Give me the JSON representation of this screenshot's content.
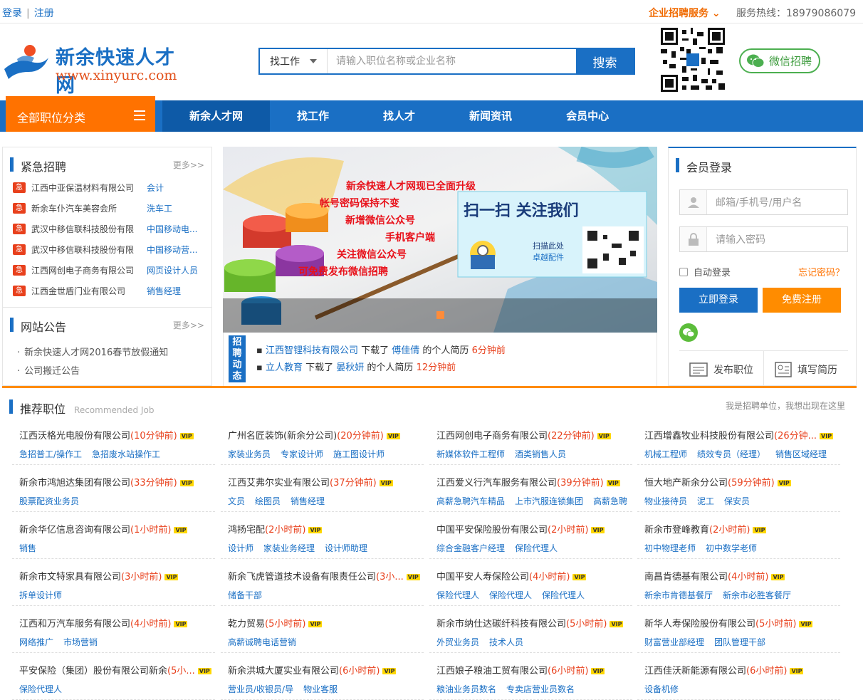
{
  "topbar": {
    "login": "登录",
    "register": "注册",
    "service": "企业招聘服务",
    "hotline": "服务热线：18979086079"
  },
  "logo": {
    "title": "新余快速人才网",
    "url": "www.xinyurc.com"
  },
  "search": {
    "type": "找工作",
    "placeholder": "请输入职位名称或企业名称",
    "button": "搜索"
  },
  "wechat_btn": "微信招聘",
  "nav": {
    "all": "全部职位分类",
    "items": [
      "新余人才网",
      "找工作",
      "找人才",
      "新闻资讯",
      "会员中心"
    ]
  },
  "urgent": {
    "title": "紧急招聘",
    "more": "更多>>",
    "tag": "急",
    "items": [
      {
        "company": "江西中亚保温材料有限公司",
        "job": "会计"
      },
      {
        "company": "新余车仆汽车美容会所",
        "job": "洗车工"
      },
      {
        "company": "武汉中移信联科技股份有限",
        "job": "中国移动电..."
      },
      {
        "company": "武汉中移信联科技股份有限",
        "job": "中国移动营..."
      },
      {
        "company": "江西网创电子商务有限公司",
        "job": "网页设计人员"
      },
      {
        "company": "江西金世盾门业有限公司",
        "job": "销售经理"
      }
    ]
  },
  "notice": {
    "title": "网站公告",
    "more": "更多>>",
    "items": [
      "新余快速人才网2016春节放假通知",
      "公司搬迁公告"
    ]
  },
  "banner": {
    "lines": [
      "新余快速人才网现已全面升级",
      "帐号密码保持不变",
      "新增微信公众号",
      "手机客户端",
      "关注微信公众号",
      "可免费发布微信招聘"
    ],
    "scan": "扫一扫 关注我们",
    "scan_here": "扫描此处",
    "brand": "卓越配件"
  },
  "dynamics": {
    "label": "招聘动态",
    "rows": [
      {
        "company": "江西智锂科技有限公司",
        "action": "下载了",
        "person": "傅佳倩",
        "suffix": "的个人简历",
        "time": "6分钟前"
      },
      {
        "company": "立人教育",
        "action": "下载了",
        "person": "晏秋妍",
        "suffix": "的个人简历",
        "time": "12分钟前"
      }
    ]
  },
  "login": {
    "title": "会员登录",
    "user_ph": "邮箱/手机号/用户名",
    "pwd_ph": "请输入密码",
    "auto": "自动登录",
    "forget": "忘记密码？",
    "login_btn": "立即登录",
    "reg_btn": "免费注册",
    "post_job": "发布职位",
    "fill_resume": "填写简历"
  },
  "recommend": {
    "title": "推荐职位",
    "sub": "Recommended Job",
    "hint": "我是招聘单位，我想出现在这里",
    "vip": "VIP",
    "cells": [
      {
        "company": "江西沃格光电股份有限公司",
        "time": "(10分钟前)",
        "jobs": [
          "急招普工/操作工",
          "急招废水站操作工"
        ]
      },
      {
        "company": "广州名匠装饰(新余分公司)",
        "time": "(20分钟前)",
        "jobs": [
          "家装业务员",
          "专家设计师",
          "施工图设计师"
        ]
      },
      {
        "company": "江西网创电子商务有限公司",
        "time": "(22分钟前)",
        "jobs": [
          "新媒体软件工程师",
          "酒类销售人员"
        ]
      },
      {
        "company": "江西增鑫牧业科技股份有限公司",
        "time": "(26分钟...",
        "jobs": [
          "机械工程师",
          "绩效专员（经理）",
          "销售区域经理"
        ]
      },
      {
        "company": "新余市鸿旭达集团有限公司",
        "time": "(33分钟前)",
        "jobs": [
          "股票配资业务员"
        ]
      },
      {
        "company": "江西艾弗尔实业有限公司",
        "time": "(37分钟前)",
        "jobs": [
          "文员",
          "绘图员",
          "销售经理"
        ]
      },
      {
        "company": "江西爱义行汽车服务有限公司",
        "time": "(39分钟前)",
        "jobs": [
          "高薪急聘汽车精品",
          "上市汽服连锁集团",
          "高薪急聘"
        ]
      },
      {
        "company": "恒大地产新余分公司",
        "time": "(59分钟前)",
        "jobs": [
          "物业接待员",
          "泥工",
          "保安员"
        ]
      },
      {
        "company": "新余华亿信息咨询有限公司",
        "time": "(1小时前)",
        "jobs": [
          "销售"
        ]
      },
      {
        "company": "鸿扬宅配",
        "time": "(2小时前)",
        "jobs": [
          "设计师",
          "家装业务经理",
          "设计师助理"
        ]
      },
      {
        "company": "中国平安保险股份有限公司",
        "time": "(2小时前)",
        "jobs": [
          "综合金融客户经理",
          "保险代理人"
        ]
      },
      {
        "company": "新余市登峰教育",
        "time": "(2小时前)",
        "jobs": [
          "初中物理老师",
          "初中数学老师"
        ]
      },
      {
        "company": "新余市文特家具有限公司",
        "time": "(3小时前)",
        "jobs": [
          "拆单设计师"
        ]
      },
      {
        "company": "新余飞虎管道技术设备有限责任公司",
        "time": "(3小...",
        "jobs": [
          "储备干部"
        ]
      },
      {
        "company": "中国平安人寿保险公司",
        "time": "(4小时前)",
        "jobs": [
          "保险代理人",
          "保险代理人",
          "保险代理人"
        ]
      },
      {
        "company": "南昌肯德基有限公司",
        "time": "(4小时前)",
        "jobs": [
          "新余市肯德基餐厅",
          "新余市必胜客餐厅"
        ]
      },
      {
        "company": "江西和万汽车服务有限公司",
        "time": "(4小时前)",
        "jobs": [
          "网络推广",
          "市场营销"
        ]
      },
      {
        "company": "乾力贸易",
        "time": "(5小时前)",
        "jobs": [
          "高薪诚聘电话营销"
        ]
      },
      {
        "company": "新余市纳仕达碳纤科技有限公司",
        "time": "(5小时前)",
        "jobs": [
          "外贸业务员",
          "技术人员"
        ]
      },
      {
        "company": "新华人寿保险股份有限公司",
        "time": "(5小时前)",
        "jobs": [
          "财富营业部经理",
          "团队管理干部"
        ]
      },
      {
        "company": "平安保险（集团）股份有限公司新余",
        "time": "(5小...",
        "jobs": [
          "保险代理人"
        ]
      },
      {
        "company": "新余洪城大厦实业有限公司",
        "time": "(6小时前)",
        "jobs": [
          "营业员/收银员/导",
          "物业客服"
        ]
      },
      {
        "company": "江西娘子粮油工贸有限公司",
        "time": "(6小时前)",
        "jobs": [
          "粮油业务员数名",
          "专卖店营业员数名"
        ]
      },
      {
        "company": "江西佳沃新能源有限公司",
        "time": "(6小时前)",
        "jobs": [
          "设备机修"
        ]
      }
    ]
  },
  "colors": {
    "blue": "#1a6fc4",
    "orange": "#ff7200",
    "red": "#e8401c"
  }
}
